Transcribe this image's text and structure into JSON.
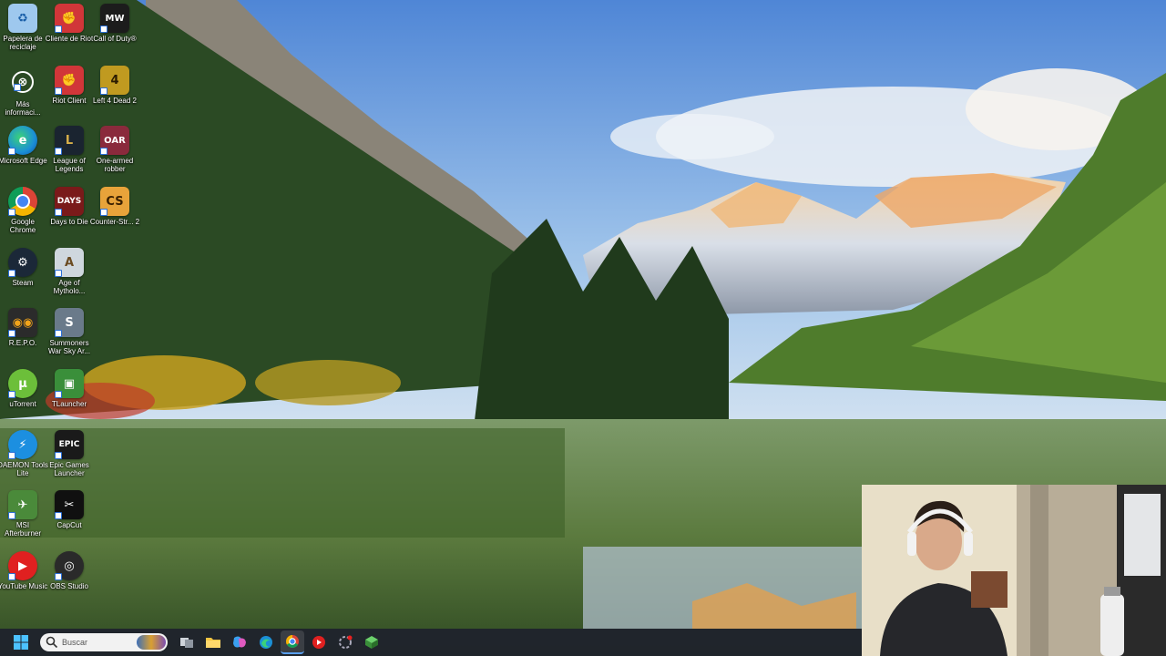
{
  "desktop": {
    "icons": [
      {
        "label": "Papelera de reciclaje",
        "icon": "recycle-bin-icon",
        "color": "#9ec8ee"
      },
      {
        "label": "Cliente de Riot",
        "icon": "riot-client-icon",
        "color": "#d13639"
      },
      {
        "label": "Call of Duty®",
        "icon": "call-of-duty-icon",
        "color": "#1c1c1c"
      },
      {
        "label": "Más informaci...",
        "icon": "info-icon",
        "color": "#3a3a3a"
      },
      {
        "label": "Riot Client",
        "icon": "riot-client-icon",
        "color": "#d13639"
      },
      {
        "label": "Left 4 Dead 2",
        "icon": "left4dead-icon",
        "color": "#c09a20"
      },
      {
        "label": "Microsoft Edge",
        "icon": "edge-icon",
        "color": "#1b8fd6"
      },
      {
        "label": "League of Legends",
        "icon": "league-icon",
        "color": "#b8922f"
      },
      {
        "label": "One-armed robber",
        "icon": "oar-icon",
        "color": "#8a2a3c"
      },
      {
        "label": "Google Chrome",
        "icon": "chrome-icon",
        "color": "#dd4b39"
      },
      {
        "label": "Days to Die",
        "icon": "days-to-die-icon",
        "color": "#7a1a1a"
      },
      {
        "label": "Counter-Str... 2",
        "icon": "counter-strike-icon",
        "color": "#e8a33a"
      },
      {
        "label": "Steam",
        "icon": "steam-icon",
        "color": "#1b2838"
      },
      {
        "label": "Age of Mytholo...",
        "icon": "age-of-mythology-icon",
        "color": "#cfd7de"
      },
      {
        "label": "R.E.P.O.",
        "icon": "repo-icon",
        "color": "#2b2b2b"
      },
      {
        "label": "Summoners War Sky Ar...",
        "icon": "summoners-war-icon",
        "color": "#6a7a8a"
      },
      {
        "label": "uTorrent",
        "icon": "utorrent-icon",
        "color": "#6cbf3a"
      },
      {
        "label": "TLauncher",
        "icon": "tlauncher-icon",
        "color": "#3a8f3a"
      },
      {
        "label": "DAEMON Tools Lite",
        "icon": "daemon-tools-icon",
        "color": "#1c8fe0"
      },
      {
        "label": "Epic Games Launcher",
        "icon": "epic-games-icon",
        "color": "#1a1a1a"
      },
      {
        "label": "MSI Afterburner",
        "icon": "msi-afterburner-icon",
        "color": "#4a8a3a"
      },
      {
        "label": "CapCut",
        "icon": "capcut-icon",
        "color": "#101010"
      },
      {
        "label": "YouTube Music",
        "icon": "youtube-music-icon",
        "color": "#e02020"
      },
      {
        "label": "OBS Studio",
        "icon": "obs-icon",
        "color": "#2a2a2a"
      }
    ]
  },
  "taskbar": {
    "search_placeholder": "Buscar",
    "apps": [
      {
        "icon": "task-view-icon"
      },
      {
        "icon": "file-explorer-icon"
      },
      {
        "icon": "copilot-icon"
      },
      {
        "icon": "edge-icon"
      },
      {
        "icon": "chrome-icon"
      },
      {
        "icon": "youtube-music-icon"
      },
      {
        "icon": "riot-tray-icon"
      },
      {
        "icon": "tlauncher-icon"
      }
    ]
  }
}
